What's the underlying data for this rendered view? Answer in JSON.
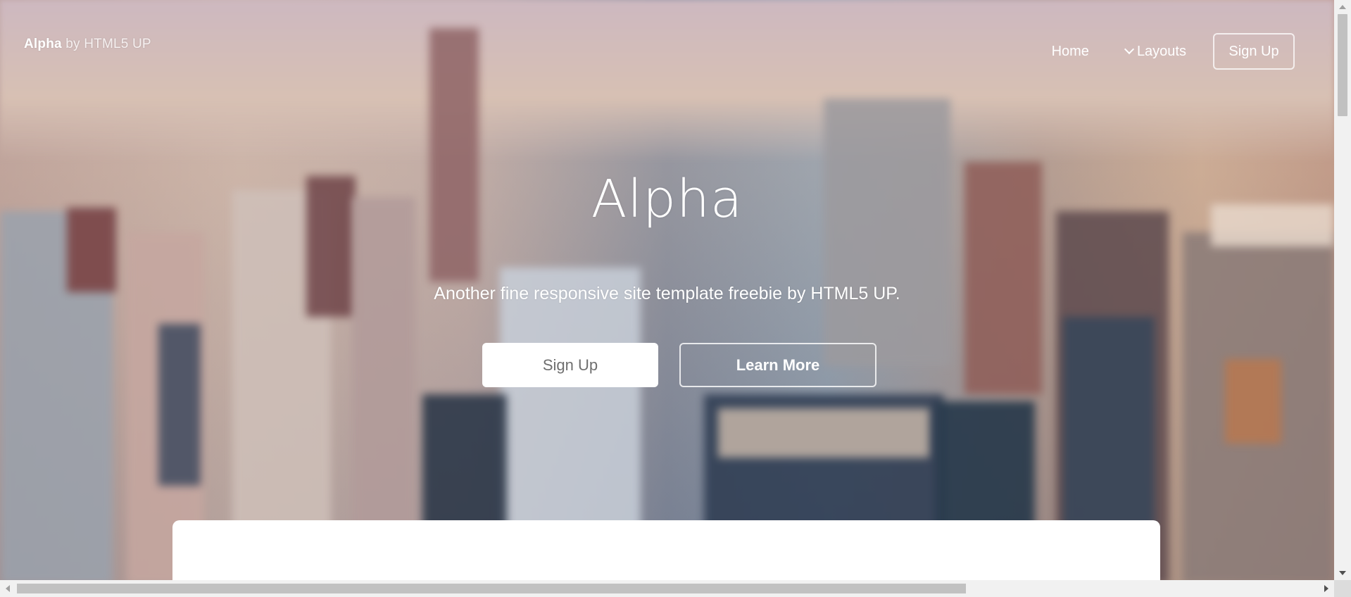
{
  "header": {
    "logo_bold": "Alpha",
    "logo_light": "by HTML5 UP",
    "nav": {
      "home": "Home",
      "layouts": "Layouts",
      "signup": "Sign Up"
    }
  },
  "hero": {
    "title": "Alpha",
    "subtitle": "Another fine responsive site template freebie by HTML5 UP.",
    "primary_button": "Sign Up",
    "secondary_button": "Learn More"
  },
  "icons": {
    "layouts_dropdown": "chevron-down-icon"
  },
  "colors": {
    "primary_button_bg": "#ffffff",
    "primary_button_text": "#6f6f6f",
    "hero_text": "#ffffff"
  }
}
